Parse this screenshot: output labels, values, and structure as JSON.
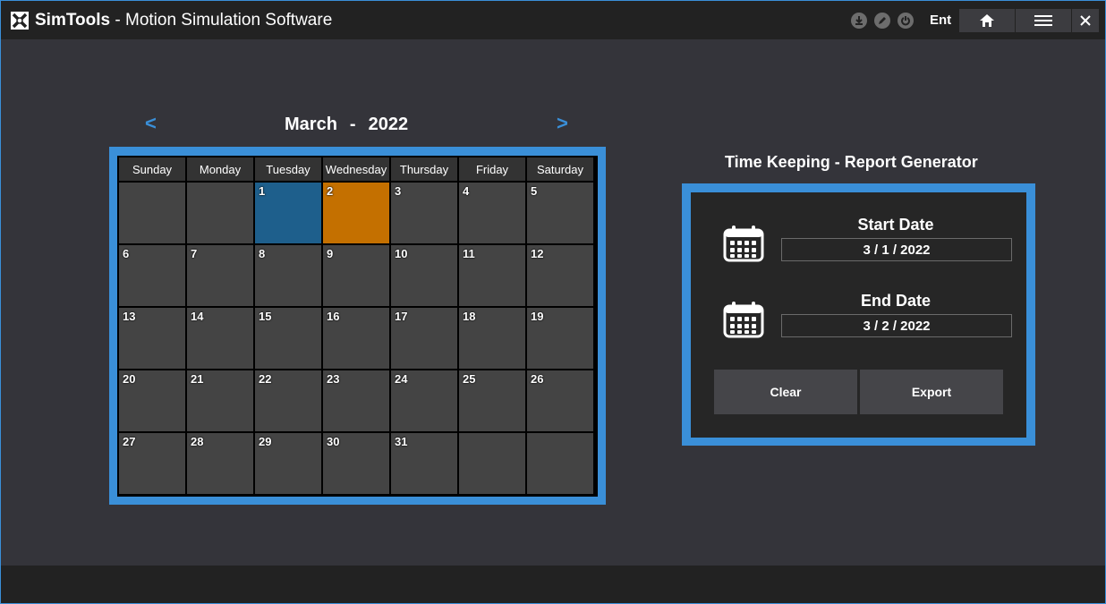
{
  "titlebar": {
    "brand": "SimTools",
    "title": " - Motion Simulation Software",
    "user": "Ent",
    "icons": [
      "download-icon",
      "edit-icon",
      "power-icon"
    ],
    "buttons": [
      "home-icon",
      "menu-icon",
      "close-icon"
    ]
  },
  "calendar": {
    "month": "March",
    "separator": "-",
    "year": "2022",
    "prev_label": "<",
    "next_label": ">",
    "weekdays": [
      "Sunday",
      "Monday",
      "Tuesday",
      "Wednesday",
      "Thursday",
      "Friday",
      "Saturday"
    ],
    "first_weekday_index": 2,
    "days_in_month": 31,
    "selected_start_day": 1,
    "selected_end_day": 2,
    "colors": {
      "start": "#1e5f8c",
      "end": "#c47000",
      "frame": "#3a8fd8"
    }
  },
  "report": {
    "title": "Time Keeping - Report Generator",
    "start_label": "Start Date",
    "start_value": "3 / 1 / 2022",
    "end_label": "End Date",
    "end_value": "3 / 2 / 2022",
    "clear_label": "Clear",
    "export_label": "Export"
  }
}
